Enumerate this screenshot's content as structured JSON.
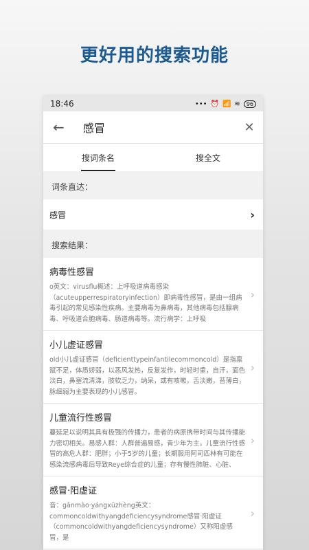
{
  "headline": "更好用的搜索功能",
  "status": {
    "time": "18:46",
    "battery": "96"
  },
  "search": {
    "query": "感冒"
  },
  "tabs": [
    {
      "label": "搜词条名"
    },
    {
      "label": "搜全文"
    }
  ],
  "direct": {
    "label": "词条直达：",
    "item": "感冒"
  },
  "results_label": "搜索结果：",
  "results": [
    {
      "title": "病毒性感冒",
      "desc": "o英文：virusflu概述：上呼吸道病毒感染（acuteupperrespiratoryinfection）即病毒性感冒，是由一组病毒引起的常见感染性疾病。主要病毒为鼻病毒，其他病毒包括腺病毒、呼吸道合胞病毒、肠道病毒等。流行病学：上呼吸"
    },
    {
      "title": "小儿虚证感冒",
      "desc": "old小儿虚证感冒（deficienttypeinfantilecommoncold）是指禀赋不足，体质娇弱，以恶风发热，反复发作，时轻时重，自汗，面色淡白，鼻塞流清涕，肢软乏力，纳呆，或有咳嗽，舌淡嫩，苔薄白，脉细弱为主要表现的小儿感冒。"
    },
    {
      "title": "儿童流行性感冒",
      "desc": "蔓延足以说明其具有极强的传播力，患者的病原携带时间与其传播能力密切相关。易感人群：人群普遍易感，青少年为主。儿童流行性感冒的高危人群：肥胖；小于5岁的儿童；长期服用阿司匹林有可能在感染流感病毒后导致Reye综合症的儿童；存有慢性肺脏、心脏、"
    },
    {
      "title": "感冒·阳虚证",
      "desc": "音：gǎnmào·yángxūzhèng英文：commoncoldwithyangdeficiencysyndrome感冒·阳虚证（commoncoldwithyangdeficiencysyndrome）又称阳虚感冒，是"
    }
  ]
}
